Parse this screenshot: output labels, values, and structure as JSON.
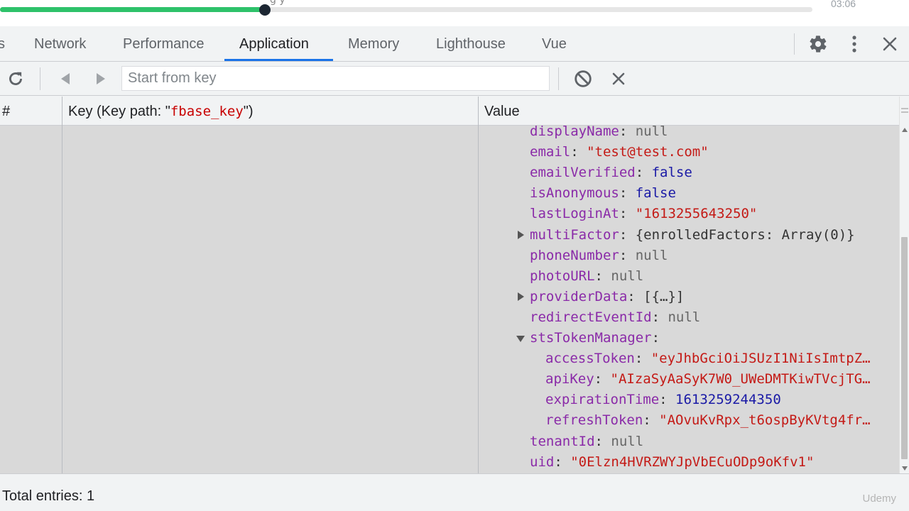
{
  "video": {
    "progress_fraction": 0.326,
    "time": "03:06",
    "cut_title_fragment": "g y"
  },
  "tabs": [
    {
      "label": "s"
    },
    {
      "label": "Network"
    },
    {
      "label": "Performance"
    },
    {
      "label": "Application"
    },
    {
      "label": "Memory"
    },
    {
      "label": "Lighthouse"
    },
    {
      "label": "Vue"
    }
  ],
  "active_tab": "Application",
  "icons": {
    "settings": "gear-icon",
    "more": "kebab-menu-icon",
    "close": "close-icon",
    "refresh": "refresh-icon",
    "prev": "triangle-left-icon",
    "next": "triangle-right-icon",
    "clear": "block-icon",
    "delete": "x-icon"
  },
  "toolbar": {
    "search_placeholder": "Start from key"
  },
  "table": {
    "col_index": "#",
    "col_key_prefix": "Key (Key path: \"",
    "col_key_path": "fbase_key",
    "col_key_suffix": "\")",
    "col_value": "Value"
  },
  "value_tree": [
    {
      "key": "displayName",
      "sep": ": ",
      "value": "null",
      "type": "null"
    },
    {
      "key": "email",
      "sep": ": ",
      "value": "\"test@test.com\"",
      "type": "str"
    },
    {
      "key": "emailVerified",
      "sep": ": ",
      "value": "false",
      "type": "bool"
    },
    {
      "key": "isAnonymous",
      "sep": ": ",
      "value": "false",
      "type": "bool"
    },
    {
      "key": "lastLoginAt",
      "sep": ": ",
      "value": "\"1613255643250\"",
      "type": "str"
    },
    {
      "key": "multiFactor",
      "sep": ": ",
      "value": "{enrolledFactors: Array(0)}",
      "type": "p",
      "toggle": "right"
    },
    {
      "key": "phoneNumber",
      "sep": ": ",
      "value": "null",
      "type": "null"
    },
    {
      "key": "photoURL",
      "sep": ": ",
      "value": "null",
      "type": "null"
    },
    {
      "key": "providerData",
      "sep": ": ",
      "value": "[{…}]",
      "type": "p",
      "toggle": "right"
    },
    {
      "key": "redirectEventId",
      "sep": ": ",
      "value": "null",
      "type": "null"
    },
    {
      "key": "stsTokenManager",
      "sep": ":",
      "value": "",
      "type": "p",
      "toggle": "down"
    },
    {
      "key": "accessToken",
      "sep": ": ",
      "value": "\"eyJhbGciOiJSUzI1NiIsImtpZ…",
      "type": "str",
      "nested": true
    },
    {
      "key": "apiKey",
      "sep": ": ",
      "value": "\"AIzaSyAaSyK7W0_UWeDMTKiwTVcjTG…",
      "type": "str",
      "nested": true
    },
    {
      "key": "expirationTime",
      "sep": ": ",
      "value": "1613259244350",
      "type": "num",
      "nested": true
    },
    {
      "key": "refreshToken",
      "sep": ": ",
      "value": "\"AOvuKvRpx_t6ospByKVtg4fr…",
      "type": "str",
      "nested": true
    },
    {
      "key": "tenantId",
      "sep": ": ",
      "value": "null",
      "type": "null"
    },
    {
      "key": "uid",
      "sep": ": ",
      "value": "\"0Elzn4HVRZWYJpVbECuODp9oKfv1\"",
      "type": "str"
    }
  ],
  "footer": {
    "total_entries": "Total entries: 1",
    "watermark": "Udemy"
  }
}
